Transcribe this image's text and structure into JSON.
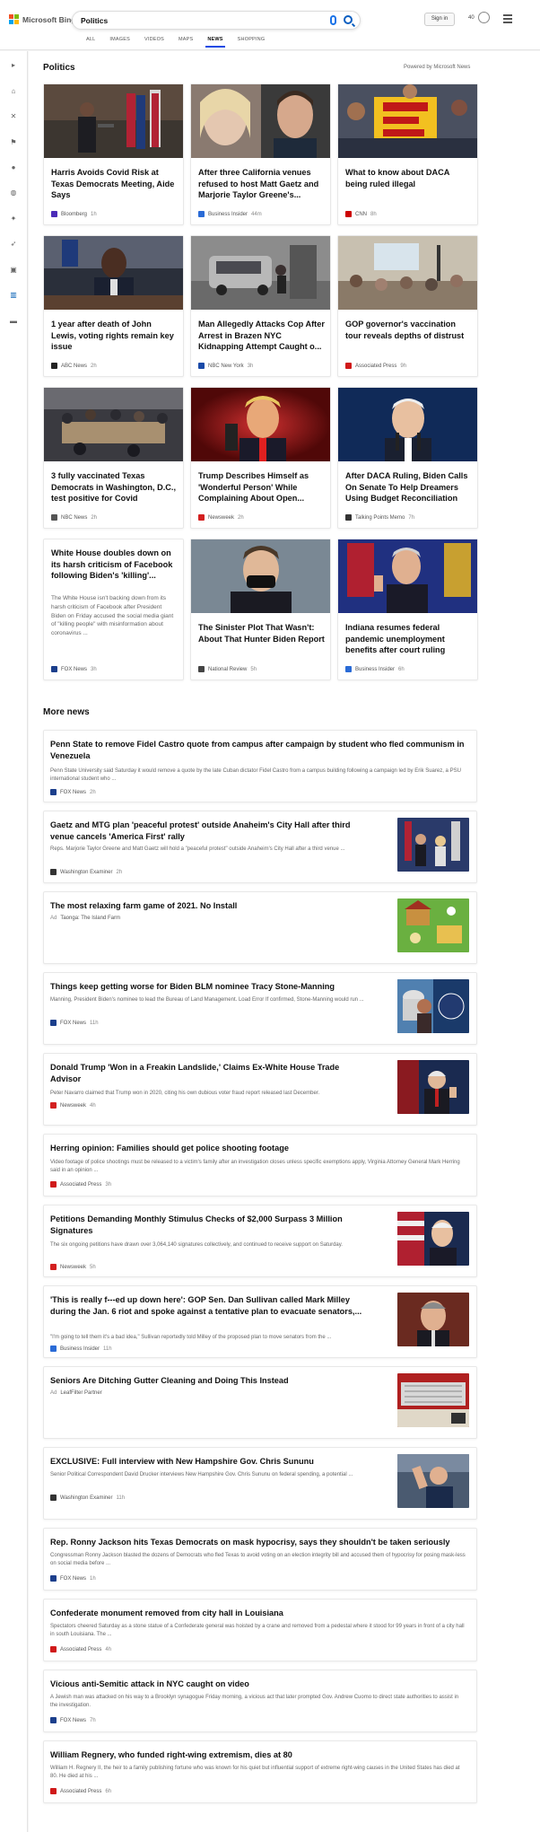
{
  "header": {
    "logo_text": "Microsoft Bing",
    "search_query": "Politics",
    "signin_label": "Sign in",
    "points": "40",
    "tabs": [
      "ALL",
      "IMAGES",
      "VIDEOS",
      "MAPS",
      "NEWS",
      "SHOPPING"
    ],
    "active_tab": "NEWS"
  },
  "section_politics": {
    "title": "Politics",
    "powered_by": "Powered by Microsoft News"
  },
  "cards": [
    {
      "title": "Harris Avoids Covid Risk at Texas Democrats Meeting, Aide Says",
      "source": "Bloomberg",
      "time": "1h",
      "logo_color": "#4b2bb8"
    },
    {
      "title": "After three California venues refused to host Matt Gaetz and Marjorie Taylor Greene's...",
      "source": "Business Insider",
      "time": "44m",
      "logo_color": "#2a6bd6"
    },
    {
      "title": "What to know about DACA being ruled illegal",
      "source": "CNN",
      "time": "8h",
      "logo_color": "#cc0000"
    },
    {
      "title": "1 year after death of John Lewis, voting rights remain key issue",
      "source": "ABC News",
      "time": "2h",
      "logo_color": "#222222"
    },
    {
      "title": "Man Allegedly Attacks Cop After Arrest in Brazen NYC Kidnapping Attempt Caught o...",
      "source": "NBC New York",
      "time": "3h",
      "logo_color": "#1a4aa8"
    },
    {
      "title": "GOP governor's vaccination tour reveals depths of distrust",
      "source": "Associated Press",
      "time": "9h",
      "logo_color": "#d01a1a"
    },
    {
      "title": "3 fully vaccinated Texas Democrats in Washington, D.C., test positive for Covid",
      "source": "NBC News",
      "time": "2h",
      "logo_color": "#555555"
    },
    {
      "title": "Trump Describes Himself as 'Wonderful Person' While Complaining About Open...",
      "source": "Newsweek",
      "time": "2h",
      "logo_color": "#d32020"
    },
    {
      "title": "After DACA Ruling, Biden Calls On Senate To Help Dreamers Using Budget Reconciliation",
      "source": "Talking Points Memo",
      "time": "7h",
      "logo_color": "#333333"
    },
    {
      "title": "White House doubles down on its harsh criticism of Facebook following Biden's 'killing'...",
      "snippet": "The White House isn't backing down from its harsh criticism of Facebook after President Biden on Friday accused the social media giant of \"killing people\" with misinformation about coronavirus ...",
      "source": "FOX News",
      "time": "3h",
      "logo_color": "#1c3f8c"
    },
    {
      "title": "The Sinister Plot That Wasn't: About That Hunter Biden Report",
      "source": "National Review",
      "time": "5h",
      "logo_color": "#444444"
    },
    {
      "title": "Indiana resumes federal pandemic unemployment benefits after court ruling",
      "source": "Business Insider",
      "time": "6h",
      "logo_color": "#2a6bd6"
    }
  ],
  "section_more": {
    "title": "More news"
  },
  "more_news": [
    {
      "title": "Penn State to remove Fidel Castro quote from campus after campaign by student who fled communism in Venezuela",
      "snippet": "Penn State University said Saturday it would remove a quote by the late Cuban dictator Fidel Castro from a campus building following a campaign led by Erik Suarez, a PSU international student who ...",
      "source": "FOX News",
      "time": "2h",
      "logo_color": "#1c3f8c"
    },
    {
      "title": "Gaetz and MTG plan 'peaceful protest' outside Anaheim's City Hall after third venue cancels 'America First' rally",
      "snippet": "Reps. Marjorie Taylor Greene and Matt Gaetz will hold a \"peaceful protest\" outside Anaheim's City Hall after a third venue ...",
      "source": "Washington Examiner",
      "time": "2h",
      "logo_color": "#333333"
    },
    {
      "title": "The most relaxing farm game of 2021. No Install",
      "ad": "Ad",
      "source": "Taonga: The Island Farm"
    },
    {
      "title": "Things keep getting worse for Biden BLM nominee Tracy Stone-Manning",
      "snippet": "Manning, President Biden's nominee to lead the Bureau of Land Management. Load Error If confirmed, Stone-Manning would run ...",
      "source": "FOX News",
      "time": "11h",
      "logo_color": "#1c3f8c"
    },
    {
      "title": "Donald Trump 'Won in a Freakin Landslide,' Claims Ex-White House Trade Advisor",
      "snippet": "Peter Navarro claimed that Trump won in 2020, citing his own dubious voter fraud report released last December.",
      "source": "Newsweek",
      "time": "4h",
      "logo_color": "#d32020"
    },
    {
      "title": "Herring opinion: Families should get police shooting footage",
      "snippet": "Video footage of police shootings must be released to a victim's family after an investigation closes unless specific exemptions apply, Virginia Attorney General Mark Herring said in an opinion ...",
      "source": "Associated Press",
      "time": "3h",
      "logo_color": "#d01a1a"
    },
    {
      "title": "Petitions Demanding Monthly Stimulus Checks of $2,000 Surpass 3 Million Signatures",
      "snippet": "The six ongoing petitions have drawn over 3,064,140 signatures collectively, and continued to receive support on Saturday.",
      "source": "Newsweek",
      "time": "5h",
      "logo_color": "#d32020"
    },
    {
      "title": "'This is really f---ed up down here': GOP Sen. Dan Sullivan called Mark Milley during the Jan. 6 riot and spoke against a tentative plan to evacuate senators,...",
      "snippet": "\"I'm going to tell them it's a bad idea,\" Sullivan reportedly told Milley of the proposed plan to move senators from the ...",
      "source": "Business Insider",
      "time": "11h",
      "logo_color": "#2a6bd6"
    },
    {
      "title": "Seniors Are Ditching Gutter Cleaning and Doing This Instead",
      "ad": "Ad",
      "source": "LeafFilter Partner"
    },
    {
      "title": "EXCLUSIVE: Full interview with New Hampshire Gov. Chris Sununu",
      "snippet": "Senior Political Correspondent David Drucker interviews New Hampshire Gov. Chris Sununu on federal spending, a potential ...",
      "source": "Washington Examiner",
      "time": "11h",
      "logo_color": "#333333"
    },
    {
      "title": "Rep. Ronny Jackson hits Texas Democrats on mask hypocrisy, says they shouldn't be taken seriously",
      "snippet": "Congressman Ronny Jackson blasted the dozens of Democrats who fled Texas to avoid voting on an election integrity bill and accused them of hypocrisy for posing mask-less on social media before ...",
      "source": "FOX News",
      "time": "1h",
      "logo_color": "#1c3f8c"
    },
    {
      "title": "Confederate monument removed from city hall in Louisiana",
      "snippet": "Spectators cheered Saturday as a stone statue of a Confederate general was hoisted by a crane and removed from a pedestal where it stood for 99 years in front of a city hall in south Louisiana. The ...",
      "source": "Associated Press",
      "time": "4h",
      "logo_color": "#d01a1a"
    },
    {
      "title": "Vicious anti-Semitic attack in NYC caught on video",
      "snippet": "A Jewish man was attacked on his way to a Brooklyn synagogue Friday morning, a vicious act that later prompted Gov. Andrew Cuomo to direct state authorities to assist in the investigation.",
      "source": "FOX News",
      "time": "7h",
      "logo_color": "#1c3f8c"
    },
    {
      "title": "William Regnery, who funded right-wing extremism, dies at 80",
      "snippet": "William H. Regnery II, the heir to a family publishing fortune who was known for his quiet but influential support of extreme right-wing causes in the United States has died at 80. He died at his ...",
      "source": "Associated Press",
      "time": "6h",
      "logo_color": "#d01a1a"
    }
  ]
}
